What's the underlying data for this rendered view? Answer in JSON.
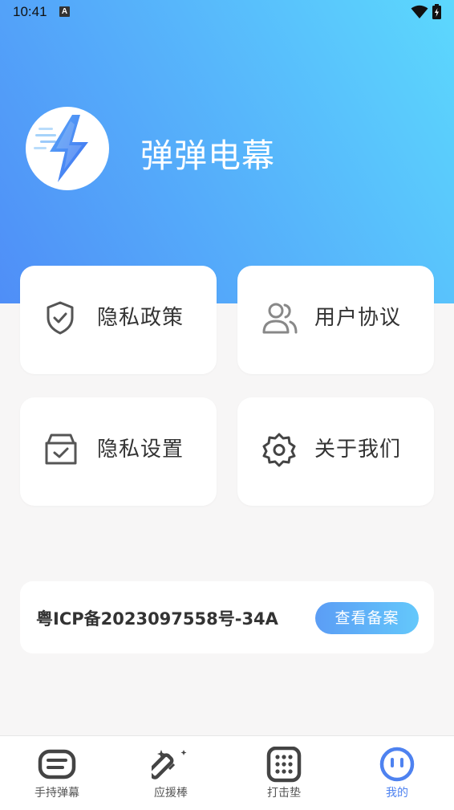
{
  "status_bar": {
    "time": "10:41",
    "notification_badge": "A"
  },
  "app": {
    "name": "弹弹电幕"
  },
  "cards": [
    {
      "id": "privacy-policy",
      "label": "隐私政策",
      "icon": "shield-check-icon"
    },
    {
      "id": "user-agreement",
      "label": "用户协议",
      "icon": "users-icon"
    },
    {
      "id": "privacy-settings",
      "label": "隐私设置",
      "icon": "box-check-icon"
    },
    {
      "id": "about-us",
      "label": "关于我们",
      "icon": "gear-icon"
    }
  ],
  "icp": {
    "text": "粤ICP备2023097558号-34A",
    "button_label": "查看备案"
  },
  "tabs": [
    {
      "label": "手持弹幕",
      "icon": "message-icon",
      "active": false
    },
    {
      "label": "应援棒",
      "icon": "magic-wand-icon",
      "active": false
    },
    {
      "label": "打击垫",
      "icon": "keypad-icon",
      "active": false
    },
    {
      "label": "我的",
      "icon": "smiley-icon",
      "active": true
    }
  ],
  "colors": {
    "gradient_start": "#4f8ef7",
    "gradient_end": "#5cd8fd",
    "active_tab": "#4e82f0",
    "background": "#f7f6f6"
  }
}
